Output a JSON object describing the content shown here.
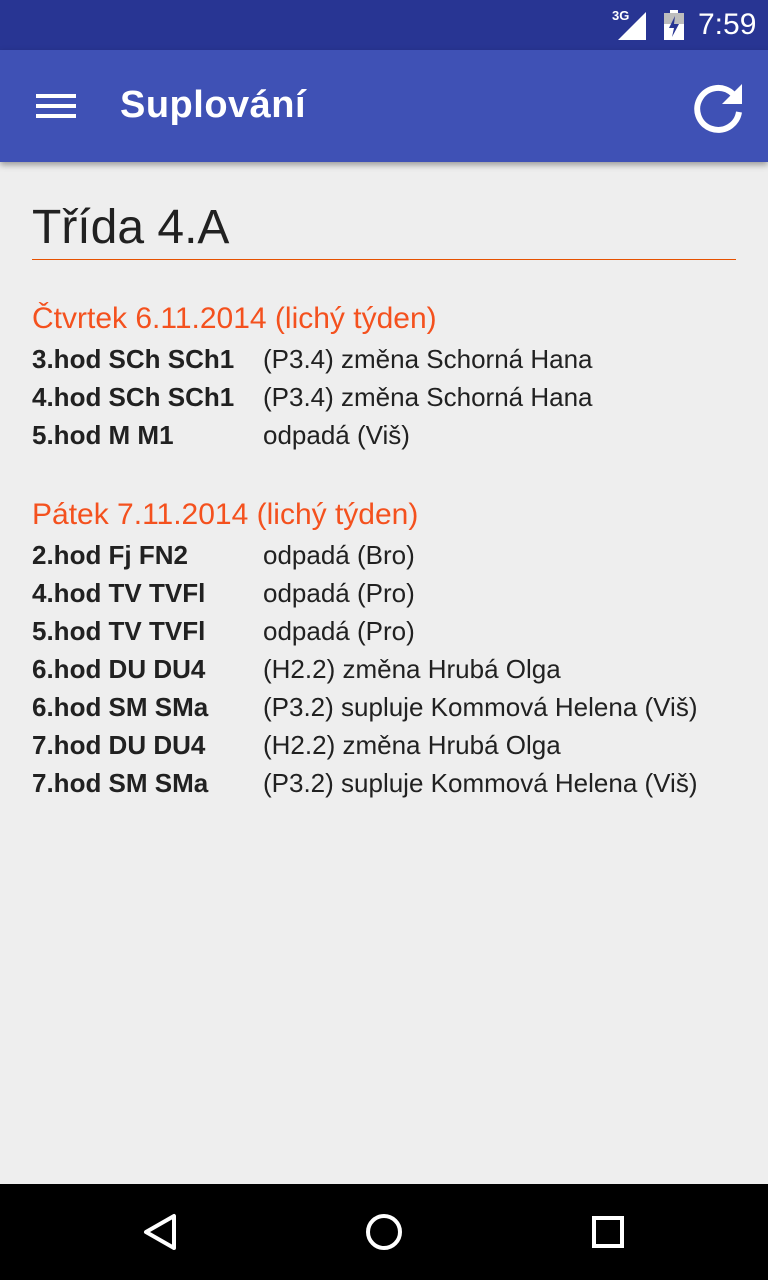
{
  "status_bar": {
    "network": "3G",
    "time": "7:59"
  },
  "app_bar": {
    "title": "Suplování",
    "menu_icon": "hamburger-menu-icon",
    "refresh_icon": "refresh-icon"
  },
  "class_title": "Třída 4.A",
  "accent_color": "#f4511e",
  "primary_color": "#3f51b5",
  "days": [
    {
      "header": "Čtvrtek 6.11.2014  (lichý týden)",
      "entries": [
        {
          "lesson": "3.hod SCh SCh1",
          "detail": "(P3.4) změna Schorná Hana"
        },
        {
          "lesson": "4.hod SCh SCh1",
          "detail": "(P3.4) změna Schorná Hana"
        },
        {
          "lesson": "5.hod M M1",
          "detail": "odpadá  (Viš)"
        }
      ]
    },
    {
      "header": "Pátek 7.11.2014  (lichý týden)",
      "entries": [
        {
          "lesson": "2.hod Fj FN2",
          "detail": "odpadá  (Bro)"
        },
        {
          "lesson": "4.hod TV TVFl",
          "detail": "odpadá  (Pro)"
        },
        {
          "lesson": "5.hod TV TVFl",
          "detail": "odpadá  (Pro)"
        },
        {
          "lesson": "6.hod DU DU4",
          "detail": "(H2.2) změna Hrubá Olga"
        },
        {
          "lesson": "6.hod SM SMa",
          "detail": "(P3.2) supluje Kommová Helena (Viš)"
        },
        {
          "lesson": "7.hod DU DU4",
          "detail": "(H2.2) změna Hrubá Olga"
        },
        {
          "lesson": "7.hod SM SMa",
          "detail": "(P3.2) supluje Kommová Helena (Viš)"
        }
      ]
    }
  ],
  "nav_bar": {
    "back_icon": "back-icon",
    "home_icon": "home-icon",
    "recents_icon": "recents-icon"
  }
}
